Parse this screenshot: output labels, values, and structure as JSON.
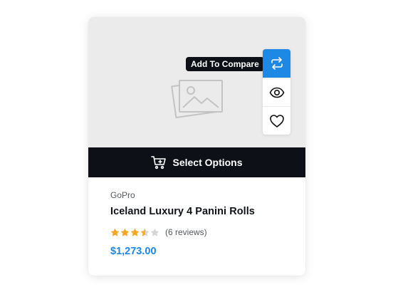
{
  "product": {
    "brand": "GoPro",
    "title": "Iceland Luxury 4 Panini Rolls",
    "rating": 3.5,
    "rating_max": 5,
    "reviews_label": "(6 reviews)",
    "price": "$1,273.00"
  },
  "actions": {
    "compare_tooltip": "Add To Compare",
    "items": [
      {
        "icon": "compare-arrows-icon",
        "active": true
      },
      {
        "icon": "eye-icon",
        "active": false
      },
      {
        "icon": "heart-icon",
        "active": false
      }
    ]
  },
  "cta": {
    "label": "Select Options",
    "icon": "cart-icon"
  },
  "colors": {
    "accent": "#1e88e5",
    "dark": "#0d1117",
    "star_filled": "#f5a623",
    "star_empty": "#d6d6d6",
    "price": "#1e88e5",
    "media_bg": "#ebebeb"
  }
}
